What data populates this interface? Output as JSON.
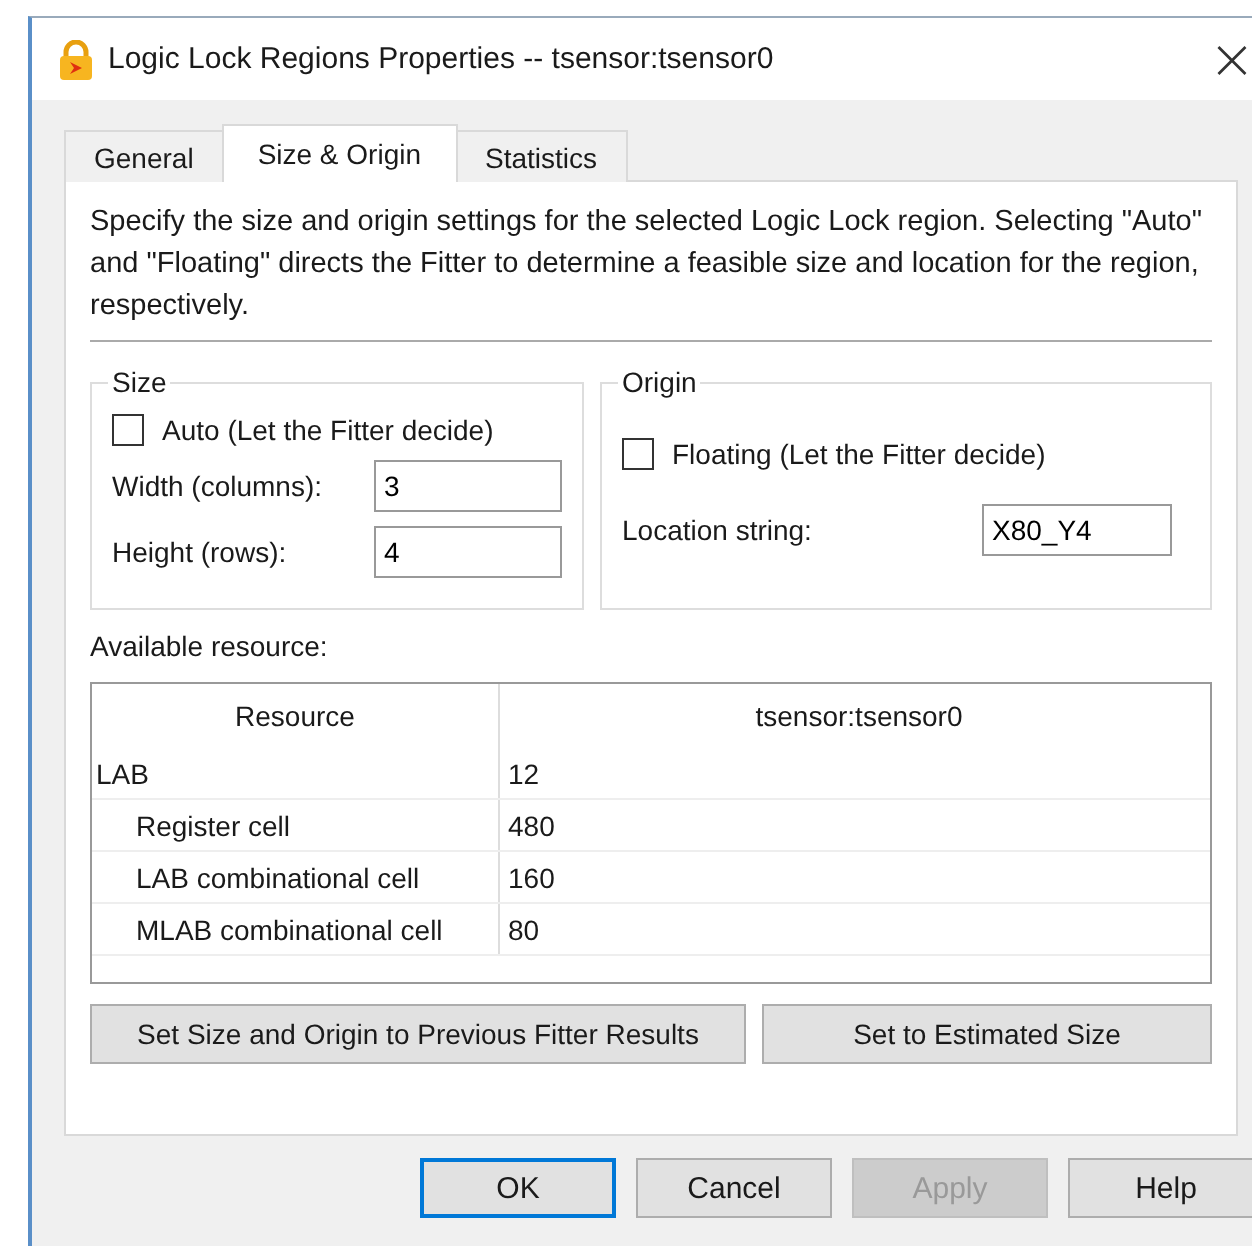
{
  "window": {
    "title": "Logic Lock Regions Properties -- tsensor:tsensor0",
    "close": "×"
  },
  "tabs": [
    {
      "label": "General",
      "selected": false
    },
    {
      "label": "Size & Origin",
      "selected": true
    },
    {
      "label": "Statistics",
      "selected": false
    }
  ],
  "description": "Specify the size and origin settings for the selected Logic Lock region. Selecting \"Auto\" and \"Floating\" directs the Fitter to determine a feasible size and location for the region, respectively.",
  "size": {
    "title": "Size",
    "auto": {
      "label": "Auto (Let the Fitter decide)",
      "checked": false
    },
    "width": {
      "label": "Width (columns):",
      "value": "3"
    },
    "height": {
      "label": "Height (rows):",
      "value": "4"
    }
  },
  "origin": {
    "title": "Origin",
    "floating": {
      "label": "Floating (Let the Fitter decide)",
      "checked": false
    },
    "location": {
      "label": "Location string:",
      "value": "X80_Y4"
    }
  },
  "resources": {
    "label": "Available resource:",
    "columns": [
      "Resource",
      "tsensor:tsensor0"
    ],
    "rows": [
      {
        "name": "LAB",
        "value": "12",
        "children": [
          {
            "name": "Register cell",
            "value": "480"
          },
          {
            "name": "LAB combinational cell",
            "value": "160"
          },
          {
            "name": "MLAB combinational cell",
            "value": "80"
          }
        ]
      }
    ]
  },
  "actions": [
    "Set Size and Origin to Previous Fitter Results",
    "Set to Estimated Size"
  ],
  "buttons": [
    {
      "label": "OK",
      "kind": "default",
      "disabled": false
    },
    {
      "label": "Cancel",
      "kind": "normal",
      "disabled": false
    },
    {
      "label": "Apply",
      "kind": "normal",
      "disabled": true
    },
    {
      "label": "Help",
      "kind": "normal",
      "disabled": false
    }
  ]
}
